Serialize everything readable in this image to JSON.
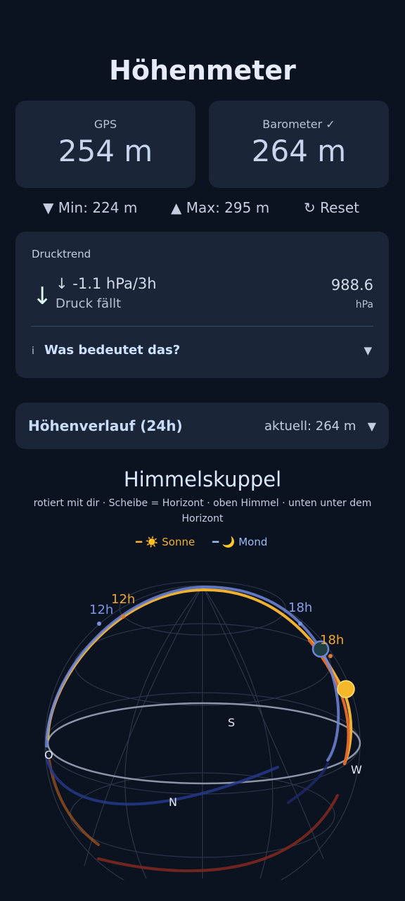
{
  "header": {
    "title": "Höhenmeter"
  },
  "cards": {
    "gps": {
      "label": "GPS",
      "value": "254 m"
    },
    "barometer": {
      "label": "Barometer ✓",
      "value": "264 m"
    }
  },
  "minmax": {
    "min_icon": "triangle-down-icon",
    "min_text": "▼  Min: 224 m",
    "max_text": "▲  Max: 295 m",
    "reset_text": "↻  Reset"
  },
  "pressure": {
    "header": "Drucktrend",
    "arrow": "↓",
    "rate": "↓ -1.1 hPa/3h",
    "status": "Druck fällt",
    "value": "988.6",
    "unit": "hPa",
    "info_icon": "i",
    "info_question": "Was bedeutet das?",
    "chevron": "▼"
  },
  "history": {
    "title": "Höhenverlauf (24h)",
    "current": "aktuell: 264 m",
    "chevron": "▼"
  },
  "sky": {
    "title": "Himmelskuppel",
    "subtitle": "rotiert mit dir · Scheibe = Horizont · oben Himmel · unten unter dem Horizont",
    "legend_sun": "━ ☀️ Sonne",
    "legend_moon": "━ 🌙 Mond",
    "labels": {
      "moon_noon": "12h",
      "sun_noon": "12h",
      "moon_evening": "18h",
      "sun_evening": "18h"
    },
    "compass": {
      "south": "S",
      "north": "N",
      "west": "W",
      "east": "O"
    },
    "colors": {
      "sun": "#f0b030",
      "moon": "#6f86d8",
      "moon_label": "#9bbcf0",
      "sun_path_low": "#d04a28"
    }
  }
}
